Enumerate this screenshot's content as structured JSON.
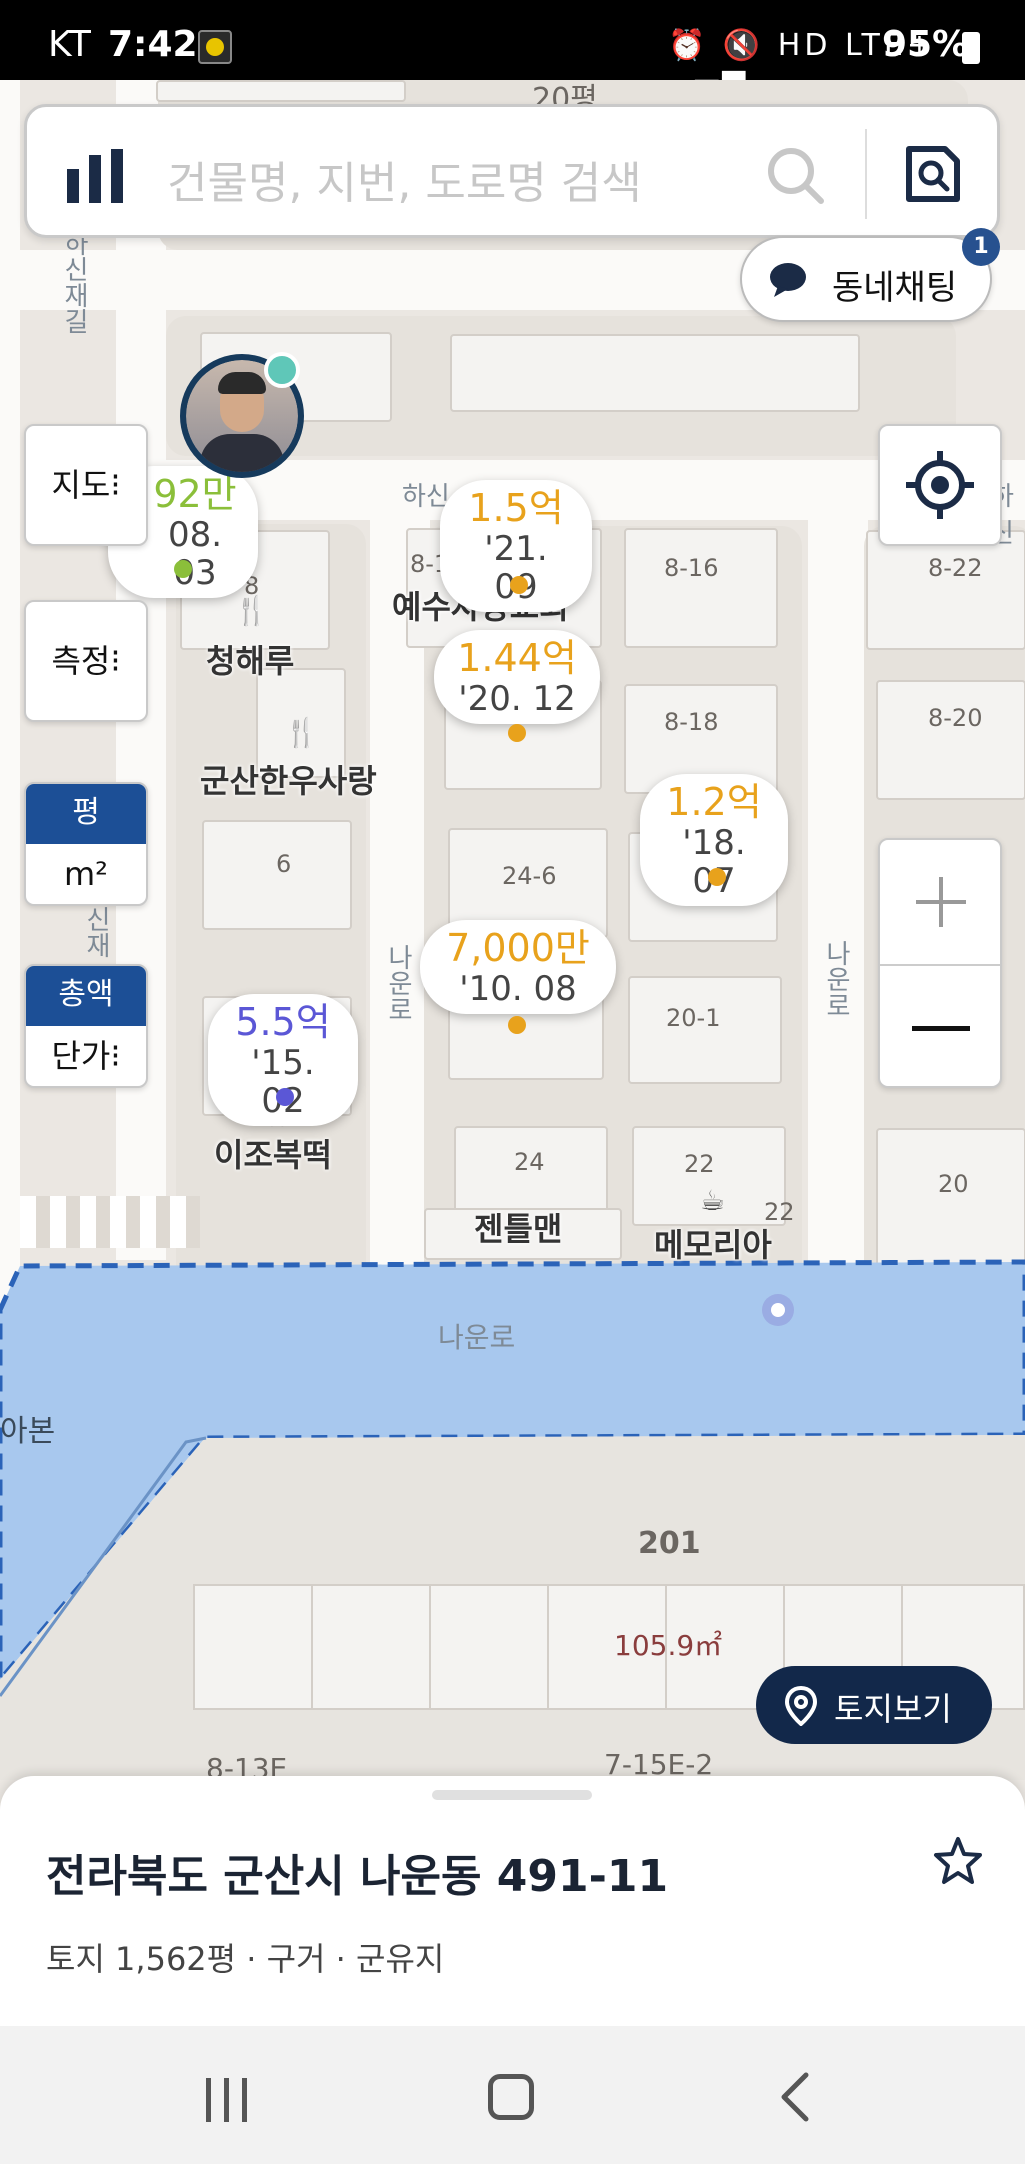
{
  "status_bar": {
    "carrier": "KT",
    "time": "7:42",
    "sys_icons": "⏰ 🔇 HD LTE+ ▂▄▆",
    "battery": "95%"
  },
  "search": {
    "placeholder": "건물명, 지번, 도로명 검색"
  },
  "chat": {
    "label": "동네채팅",
    "badge": "1"
  },
  "controls": {
    "map_label": "지도⁝",
    "measure_label": "측정⁝",
    "area_unit_top": "평",
    "area_unit_bottom": "m²",
    "price_mode_top": "총액",
    "price_mode_bottom": "단가⁝",
    "land_view_label": "토지보기",
    "accent_color": "#1c4f96"
  },
  "map": {
    "road_names": [
      "하신재길",
      "하신재",
      "하신",
      "나운로",
      "나운로",
      "나운로",
      "하신",
      "아본"
    ],
    "parcel_numbers": [
      "8",
      "8-1",
      "8-16",
      "8-22",
      "8-18",
      "8-20",
      "24-6",
      "20",
      "20-1",
      "6",
      "24",
      "22",
      "22",
      "20",
      "201",
      "8-13E",
      "7-15E-2"
    ],
    "area_label": "105.9㎡",
    "pois": [
      "청해루",
      "군산한우사랑",
      "예수사랑교회",
      "이조복떡",
      "젠틀맨",
      "메모리아"
    ],
    "top_partial_label": "20평"
  },
  "price_markers": [
    {
      "price": "92만",
      "date": "08. 03",
      "color": "#8bbf3a"
    },
    {
      "price": "1.5억",
      "date": "'21. 09",
      "color": "#e8a21c"
    },
    {
      "price": "1.44억",
      "date": "'20. 12",
      "color": "#e8a21c"
    },
    {
      "price": "1.2억",
      "date": "'18. 07",
      "color": "#e8a21c"
    },
    {
      "price": "7,000만",
      "date": "'10. 08",
      "color": "#e8a21c"
    },
    {
      "price": "5.5억",
      "date": "'15. 02",
      "color": "#5b57d6"
    }
  ],
  "sheet": {
    "address": "전라북도 군산시 나운동 491-11",
    "summary": "토지 1,562평 · 구거 · 군유지"
  }
}
